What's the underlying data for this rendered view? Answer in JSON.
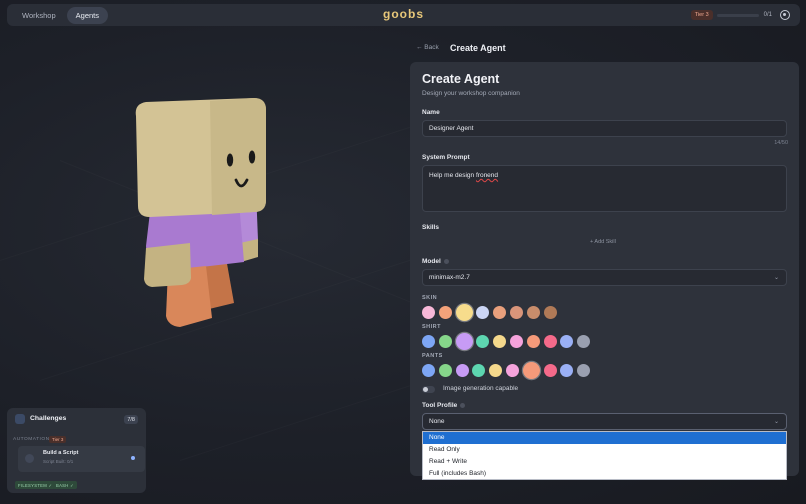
{
  "nav": {
    "tabs": [
      {
        "label": "Workshop",
        "active": false
      },
      {
        "label": "Agents",
        "active": true
      }
    ],
    "logo": "goobs",
    "tier_badge": "Tier 3",
    "progress": {
      "text": "0/1",
      "fraction": 0.0
    }
  },
  "header": {
    "back": "← Back",
    "title": "Create Agent"
  },
  "form": {
    "title": "Create Agent",
    "subtitle": "Design your workshop companion",
    "name_label": "Name",
    "name_value": "Designer Agent",
    "name_counter": "14/50",
    "prompt_label": "System Prompt",
    "prompt_value_a": "Help me design ",
    "prompt_value_b": "fronend",
    "skills_label": "Skills",
    "add_skill": "+ Add Skill",
    "model_label": "Model",
    "model_value": "minimax-m2.7",
    "skin_label": "SKIN",
    "shirt_label": "SHIRT",
    "pants_label": "PANTS",
    "toggle_label": "Image generation capable",
    "tool_profile_label": "Tool Profile",
    "tool_profile_value": "None"
  },
  "palettes": {
    "skin": [
      "#f7b8d8",
      "#f3a27a",
      "#f7dc8c",
      "#cbd5f5",
      "#e9a07c",
      "#d9957a",
      "#c98d6b",
      "#b07a57"
    ],
    "skin_selected": 2,
    "shirt": [
      "#7da6f5",
      "#86d68a",
      "#c79bf5",
      "#5dd6b0",
      "#f5d98c",
      "#f5a3dc",
      "#f59a7a",
      "#f56a8a",
      "#9ab0f5",
      "#9aa0b0"
    ],
    "shirt_selected": 2,
    "pants": [
      "#7da6f5",
      "#86d68a",
      "#c79bf5",
      "#5dd6b0",
      "#f5d98c",
      "#f5a3dc",
      "#f59a7a",
      "#f56a8a",
      "#9ab0f5",
      "#9aa0b0"
    ],
    "pants_selected": 6
  },
  "dropdown": {
    "options": [
      "None",
      "Read Only",
      "Read + Write",
      "Full (includes Bash)"
    ],
    "highlighted": 0
  },
  "challenges": {
    "title": "Challenges",
    "count": "7/8",
    "section": "AUTOMATION",
    "tier": "Tier 3",
    "item_title": "Build a Script",
    "item_sub": "Script Built: 0/1",
    "chips": [
      "FILESYSTEM ✓",
      "BASH ✓"
    ]
  },
  "colors": {
    "accent": "#e8c87a",
    "highlight": "#1f6fd1",
    "head": "#d3c395",
    "shirt": "#a97ad0",
    "pants": "#d9875a",
    "skin": "#c9b98a"
  }
}
